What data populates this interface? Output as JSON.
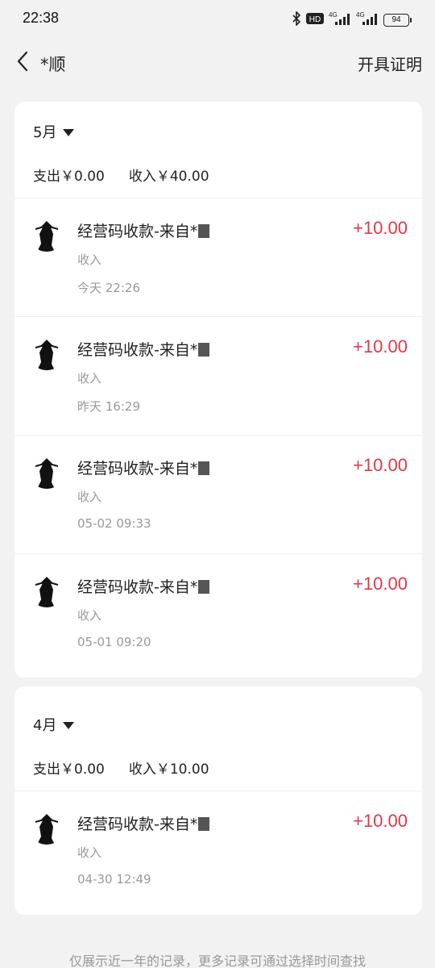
{
  "status_bar": {
    "time": "22:38",
    "network_1": "4G",
    "network_2": "4G",
    "hd_badge": "HD",
    "battery": "94"
  },
  "header": {
    "title": "*顺",
    "action_label": "开具证明"
  },
  "months": [
    {
      "label": "5月",
      "summary": {
        "expense": "支出￥0.00",
        "income": "收入￥40.00"
      },
      "transactions": [
        {
          "title": "经营码收款-来自*",
          "type": "收入",
          "time": "今天 22:26",
          "amount": "+10.00"
        },
        {
          "title": "经营码收款-来自*",
          "type": "收入",
          "time": "昨天 16:29",
          "amount": "+10.00"
        },
        {
          "title": "经营码收款-来自*",
          "type": "收入",
          "time": "05-02 09:33",
          "amount": "+10.00"
        },
        {
          "title": "经营码收款-来自*",
          "type": "收入",
          "time": "05-01 09:20",
          "amount": "+10.00"
        }
      ]
    },
    {
      "label": "4月",
      "summary": {
        "expense": "支出￥0.00",
        "income": "收入￥10.00"
      },
      "transactions": [
        {
          "title": "经营码收款-来自*",
          "type": "收入",
          "time": "04-30 12:49",
          "amount": "+10.00"
        }
      ]
    }
  ],
  "footer_note": "仅展示近一年的记录，更多记录可通过选择时间查找",
  "colors": {
    "background": "#f2f2f2",
    "card": "#ffffff",
    "income_amount": "#e0384a",
    "secondary_text": "#999999"
  }
}
